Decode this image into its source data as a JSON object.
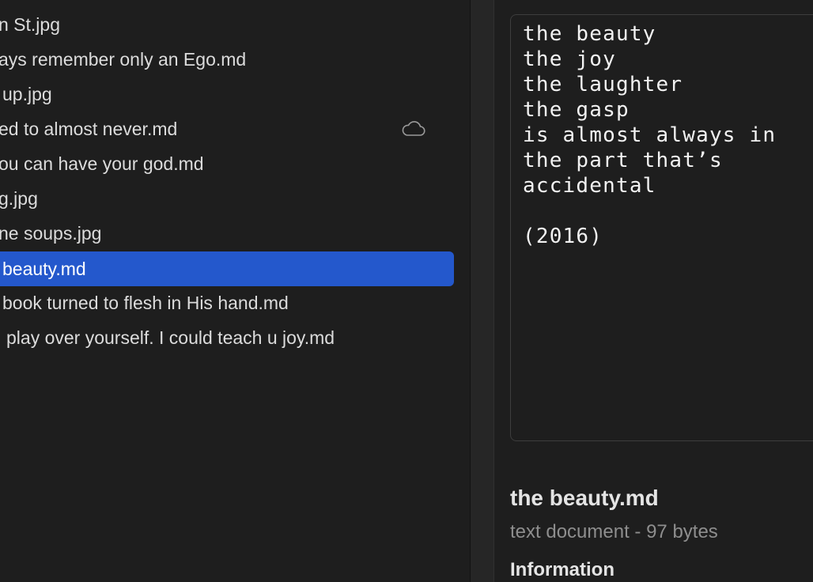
{
  "file_list": {
    "items": [
      {
        "name": "n St.jpg",
        "selected": false
      },
      {
        "name": "ays remember only an Ego.md",
        "selected": false
      },
      {
        "name": "up.jpg",
        "selected": false
      },
      {
        "name": "ed to almost never.md",
        "selected": false,
        "status_icon": "cloud-icon"
      },
      {
        "name": "ou can have your god.md",
        "selected": false
      },
      {
        "name": "g.jpg",
        "selected": false
      },
      {
        "name": "ne soups.jpg",
        "selected": false
      },
      {
        "name": "beauty.md",
        "selected": true
      },
      {
        "name": "book turned to flesh in His hand.md",
        "selected": false
      },
      {
        "name": "play over yourself. I could teach u joy.md",
        "selected": false
      }
    ]
  },
  "preview": {
    "content": "the beauty\nthe joy\nthe laughter\nthe gasp\nis almost always in\nthe part that’s\naccidental\n\n(2016)",
    "file_title": "the beauty.md",
    "file_meta": "text document - 97 bytes",
    "section_heading": "Information"
  },
  "colors": {
    "background": "#1e1e1e",
    "selection": "#2458cc",
    "text": "#dcdcdc",
    "secondary_text": "#8e8e8e"
  }
}
